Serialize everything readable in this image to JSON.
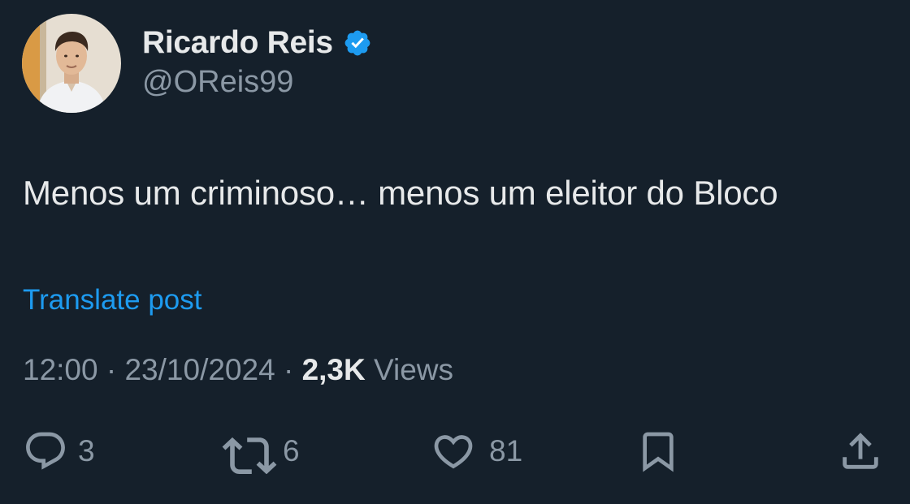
{
  "author": {
    "display_name": "Ricardo Reis",
    "handle": "@OReis99",
    "verified": true,
    "verified_color": "#1d9bf0"
  },
  "post": {
    "text": "Menos um criminoso… menos um eleitor do Bloco",
    "translate_label": "Translate post",
    "time": "12:00",
    "separator": "·",
    "date": "23/10/2024",
    "views_count": "2,3K",
    "views_label": "Views"
  },
  "actions": {
    "replies": "3",
    "reposts": "6",
    "likes": "81"
  },
  "icons": {
    "reply": "reply-icon",
    "repost": "repost-icon",
    "like": "heart-icon",
    "bookmark": "bookmark-icon",
    "share": "share-icon"
  },
  "colors": {
    "background": "#15202b",
    "text": "#e7e9ea",
    "muted": "#8b98a5",
    "accent": "#1d9bf0"
  }
}
